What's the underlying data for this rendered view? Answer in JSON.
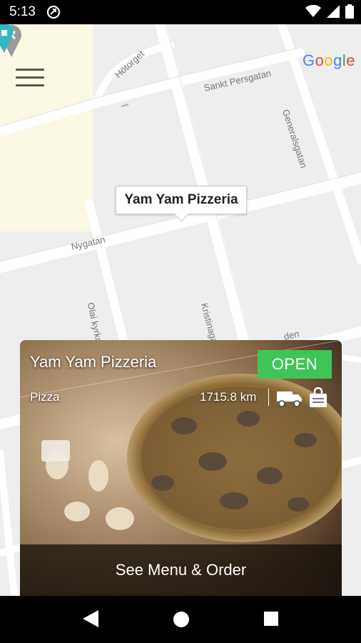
{
  "status_bar": {
    "time": "5:13",
    "icons": [
      "app-notification-icon",
      "wifi-icon",
      "signal-icon",
      "battery-icon"
    ]
  },
  "map": {
    "attribution": [
      "G",
      "o",
      "o",
      "g",
      "l",
      "e"
    ],
    "attribution_colors": [
      "#4285F4",
      "#EA4335",
      "#FBBC05",
      "#4285F4",
      "#34A853",
      "#EA4335"
    ],
    "streets": {
      "hotorget": "Hötorget",
      "sankt_persgatan": "Sankt Persgatan",
      "generalsgatan": "Generalsgatan",
      "nygatan": "Nygatan",
      "olai_kyrkogata": "Olai kyrkogata",
      "kristinagatan": "Kristinagatan",
      "partial": "den"
    },
    "marker_title": "Yam Yam Pizzeria"
  },
  "restaurant": {
    "name": "Yam Yam Pizzeria",
    "status": "OPEN",
    "category": "Pizza",
    "distance": "1715.8 km",
    "cta": "See Menu & Order",
    "open_color": "#3ec556"
  },
  "nav": {
    "back": "back-icon",
    "home": "home-icon",
    "recents": "recents-icon"
  }
}
